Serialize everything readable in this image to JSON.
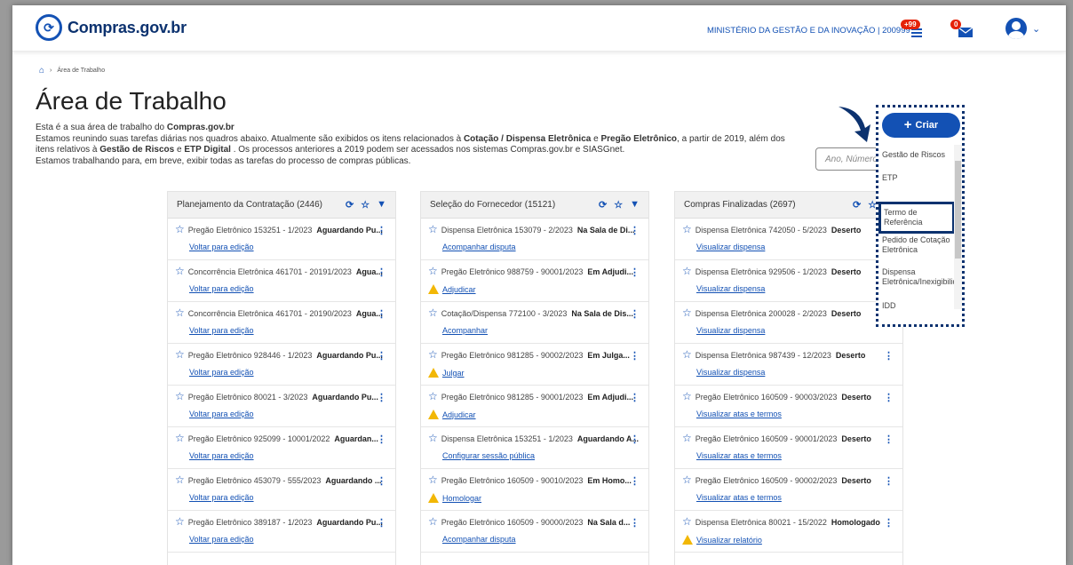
{
  "header": {
    "logo_text": "Compras.gov.br",
    "organization": "MINISTÉRIO DA GESTÃO E DA INOVAÇÃO | 200999",
    "notification_count": "+99",
    "mail_count": "0"
  },
  "breadcrumb": {
    "current": "Área de Trabalho"
  },
  "page_title": "Área de Trabalho",
  "intro": {
    "line1_pre": "Esta é a sua área de trabalho do ",
    "line1_bold": "Compras.gov.br",
    "line2_pre": "Estamos reunindo suas tarefas diárias nos quadros abaixo. Atualmente são exibidos os itens relacionados à ",
    "line2_bold1": "Cotação / Dispensa Eletrônica",
    "line2_mid": " e ",
    "line2_bold2": "Pregão Eletrônico",
    "line2_post": ", a partir de 2019, além dos itens relativos à ",
    "line2_bold3": "Gestão de Riscos",
    "line2_mid2": " e ",
    "line2_bold4": "ETP Digital",
    "line2_end": " . Os processos anteriores a 2019 podem ser acessados nos sistemas Compras.gov.br e SIASGnet.",
    "line3": "Estamos trabalhando para, em breve, exibir todas as tarefas do processo de compras públicas."
  },
  "search": {
    "placeholder": "Ano, Número"
  },
  "create_menu": {
    "button_label": "Criar",
    "items": [
      "Gestão de Riscos",
      "ETP",
      "Termo de Referência",
      "Pedido de Cotação Eletrônica",
      "Dispensa Eletrônica/Inexigibilidade",
      "IDD"
    ]
  },
  "columns": [
    {
      "title": "Planejamento da Contratação (2446)",
      "rows": [
        {
          "item": "Pregão Eletrônico 153251 - 1/2023",
          "status": "Aguardando Pu...",
          "action": "Voltar para edição",
          "warn": false
        },
        {
          "item": "Concorrência Eletrônica 461701 - 20191/2023",
          "status": "Agua...",
          "action": "Voltar para edição",
          "warn": false
        },
        {
          "item": "Concorrência Eletrônica 461701 - 20190/2023",
          "status": "Agua...",
          "action": "Voltar para edição",
          "warn": false
        },
        {
          "item": "Pregão Eletrônico 928446 - 1/2023",
          "status": "Aguardando Pu...",
          "action": "Voltar para edição",
          "warn": false
        },
        {
          "item": "Pregão Eletrônico 80021 - 3/2023",
          "status": "Aguardando Pu...",
          "action": "Voltar para edição",
          "warn": false
        },
        {
          "item": "Pregão Eletrônico 925099 - 10001/2022",
          "status": "Aguardan...",
          "action": "Voltar para edição",
          "warn": false
        },
        {
          "item": "Pregão Eletrônico 453079 - 555/2023",
          "status": "Aguardando ...",
          "action": "Voltar para edição",
          "warn": false
        },
        {
          "item": "Pregão Eletrônico 389187 - 1/2023",
          "status": "Aguardando Pu...",
          "action": "Voltar para edição",
          "warn": false
        }
      ]
    },
    {
      "title": "Seleção do Fornecedor (15121)",
      "rows": [
        {
          "item": "Dispensa Eletrônica 153079 - 2/2023",
          "status": "Na Sala de Di...",
          "action": "Acompanhar disputa",
          "warn": false
        },
        {
          "item": "Pregão Eletrônico 988759 - 90001/2023",
          "status": "Em Adjudi...",
          "action": "Adjudicar",
          "warn": true
        },
        {
          "item": "Cotação/Dispensa 772100 - 3/2023",
          "status": "Na Sala de Dis...",
          "action": "Acompanhar",
          "warn": false
        },
        {
          "item": "Pregão Eletrônico 981285 - 90002/2023",
          "status": "Em Julga...",
          "action": "Julgar",
          "warn": true
        },
        {
          "item": "Pregão Eletrônico 981285 - 90001/2023",
          "status": "Em Adjudi...",
          "action": "Adjudicar",
          "warn": true
        },
        {
          "item": "Dispensa Eletrônica 153251 - 1/2023",
          "status": "Aguardando A...",
          "action": "Configurar sessão pública",
          "warn": false
        },
        {
          "item": "Pregão Eletrônico 160509 - 90010/2023",
          "status": "Em Homo...",
          "action": "Homologar",
          "warn": true
        },
        {
          "item": "Pregão Eletrônico 160509 - 90000/2023",
          "status": "Na Sala d...",
          "action": "Acompanhar disputa",
          "warn": false
        }
      ]
    },
    {
      "title": "Compras Finalizadas (2697)",
      "rows": [
        {
          "item": "Dispensa Eletrônica 742050 - 5/2023",
          "status": "Deserto",
          "action": "Visualizar dispensa",
          "warn": false
        },
        {
          "item": "Dispensa Eletrônica 929506 - 1/2023",
          "status": "Deserto",
          "action": "Visualizar dispensa",
          "warn": false
        },
        {
          "item": "Dispensa Eletrônica 200028 - 2/2023",
          "status": "Deserto",
          "action": "Visualizar dispensa",
          "warn": false
        },
        {
          "item": "Dispensa Eletrônica 987439 - 12/2023",
          "status": "Deserto",
          "action": "Visualizar dispensa",
          "warn": false
        },
        {
          "item": "Pregão Eletrônico 160509 - 90003/2023",
          "status": "Deserto",
          "action": "Visualizar atas e termos",
          "warn": false
        },
        {
          "item": "Pregão Eletrônico 160509 - 90001/2023",
          "status": "Deserto",
          "action": "Visualizar atas e termos",
          "warn": false
        },
        {
          "item": "Pregão Eletrônico 160509 - 90002/2023",
          "status": "Deserto",
          "action": "Visualizar atas e termos",
          "warn": false
        },
        {
          "item": "Dispensa Eletrônica 80021 - 15/2022",
          "status": "Homologado",
          "action": "Visualizar relatório",
          "warn": true
        }
      ]
    }
  ],
  "colors": {
    "primary": "#1351b4",
    "dark_blue": "#0c326f",
    "badge_red": "#e52207",
    "warning": "#f2b705"
  }
}
